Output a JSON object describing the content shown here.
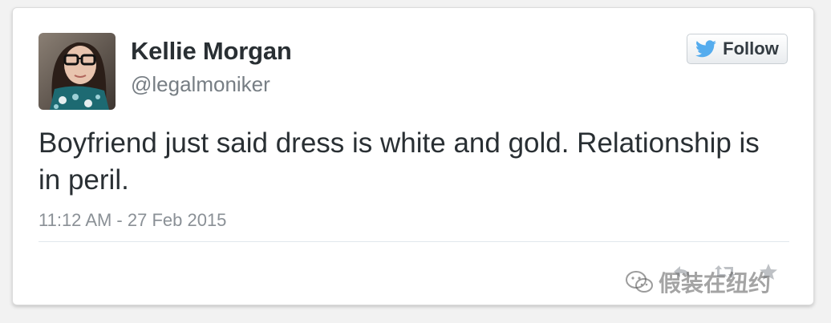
{
  "tweet": {
    "author_name": "Kellie Morgan",
    "author_handle": "@legalmoniker",
    "text": "Boyfriend just said dress is white and gold. Relationship is in peril.",
    "timestamp": "11:12 AM - 27 Feb 2015"
  },
  "follow_button": {
    "label": "Follow",
    "icon": "twitter-bird-icon"
  },
  "actions": {
    "reply_icon": "reply-icon",
    "retweet_icon": "retweet-icon",
    "favorite_icon": "star-icon"
  },
  "watermark": {
    "text": "假装在纽约",
    "icon": "wechat-icon"
  },
  "colors": {
    "brand_blue": "#55acee",
    "text_primary": "#292f33",
    "text_secondary": "#777e84"
  }
}
